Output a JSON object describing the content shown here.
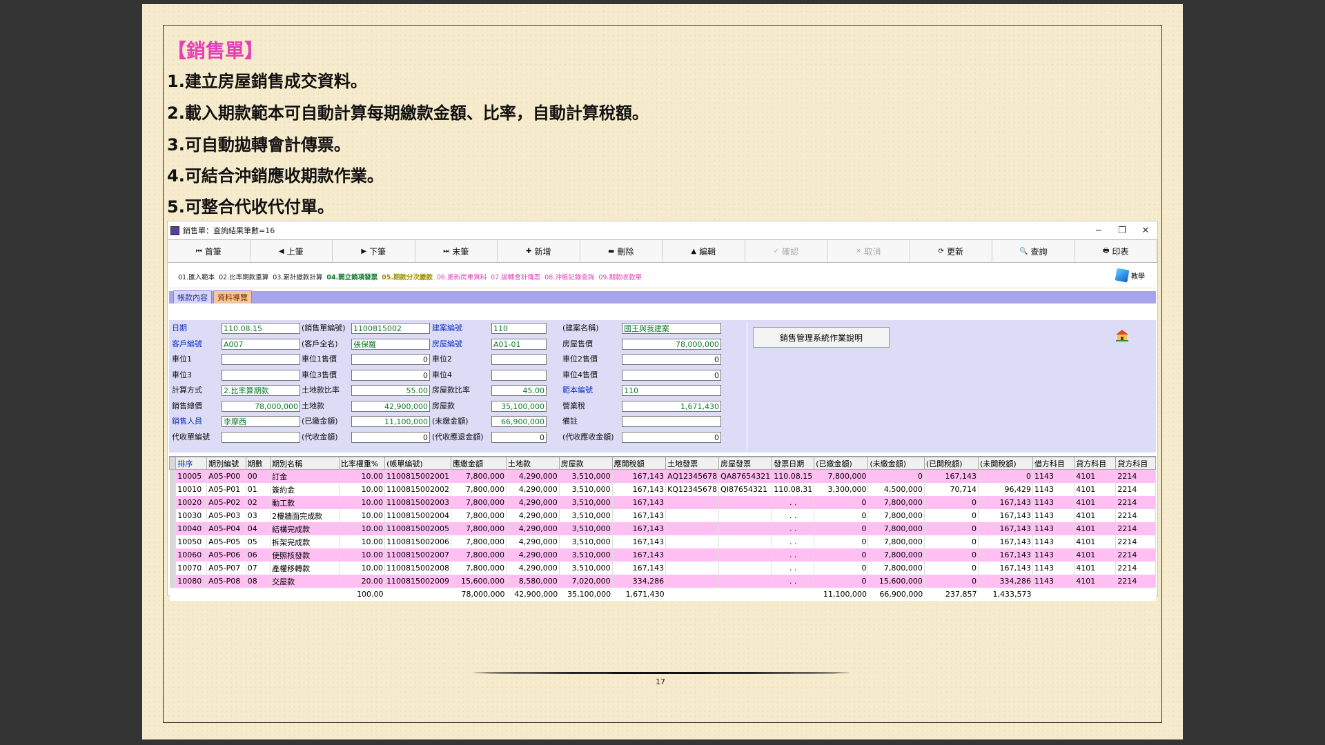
{
  "slide": {
    "title": "【銷售單】",
    "bullets": [
      "1.建立房屋銷售成交資料。",
      "2.載入期款範本可自動計算每期繳款金額、比率，自動計算稅額。",
      "3.可自動拋轉會計傳票。",
      "4.可結合沖銷應收期款作業。",
      "5.可整合代收代付單。"
    ],
    "page_number": "17"
  },
  "window": {
    "title": "銷售單：查詢結果筆數=16",
    "controls": [
      "−",
      "❐",
      "✕"
    ]
  },
  "toolbar": [
    {
      "icon": "⏮",
      "label": "首筆",
      "enabled": true
    },
    {
      "icon": "◀",
      "label": "上筆",
      "enabled": true
    },
    {
      "icon": "▶",
      "label": "下筆",
      "enabled": true
    },
    {
      "icon": "⏭",
      "label": "末筆",
      "enabled": true
    },
    {
      "icon": "✚",
      "label": "新增",
      "enabled": true
    },
    {
      "icon": "▬",
      "label": "刪除",
      "enabled": true
    },
    {
      "icon": "▲",
      "label": "編輯",
      "enabled": true
    },
    {
      "icon": "✓",
      "label": "確認",
      "enabled": false
    },
    {
      "icon": "✕",
      "label": "取消",
      "enabled": false
    },
    {
      "icon": "⟳",
      "label": "更新",
      "enabled": true
    },
    {
      "icon": "🔍",
      "label": "查詢",
      "enabled": true
    },
    {
      "icon": "🖶",
      "label": "印表",
      "enabled": true
    }
  ],
  "function_tabs": [
    {
      "label": "01.匯入範本",
      "style": "gray"
    },
    {
      "label": "02.比率期款重算",
      "style": "gray"
    },
    {
      "label": "03.累計繳款計算",
      "style": "gray"
    },
    {
      "label": "04.開立銷項發票",
      "style": "green"
    },
    {
      "label": "05.期款分次繳款",
      "style": "olive"
    },
    {
      "label": "06.更新房車資料",
      "style": "pink"
    },
    {
      "label": "07.拋轉會計傳票",
      "style": "pink"
    },
    {
      "label": "08.沖帳記錄查詢",
      "style": "pink"
    },
    {
      "label": "09.期款收款單",
      "style": "pink"
    }
  ],
  "math_button": "教學",
  "sub_tabs": [
    "帳款內容",
    "資料導覽"
  ],
  "form": {
    "rows": [
      [
        {
          "label": "日期",
          "blue": true,
          "value": "110.08.15",
          "align": "l",
          "green": true
        },
        {
          "label": "(銷售單編號)",
          "value": "1100815002",
          "align": "l",
          "green": true
        },
        {
          "label": "建案編號",
          "blue": true,
          "value": "110",
          "align": "l",
          "green": true
        },
        {
          "label": "(建案名稱)",
          "value": "國王與我建案",
          "align": "l",
          "green": true
        }
      ],
      [
        {
          "label": "客戶編號",
          "blue": true,
          "value": "A007",
          "align": "l",
          "green": true
        },
        {
          "label": "(客戶全名)",
          "value": "張保羅",
          "align": "l",
          "green": true
        },
        {
          "label": "房屋編號",
          "blue": true,
          "value": "A01-01",
          "align": "l",
          "green": true
        },
        {
          "label": "房屋售價",
          "value": "78,000,000",
          "align": "r",
          "green": true
        }
      ],
      [
        {
          "label": "車位1",
          "value": "",
          "align": "l"
        },
        {
          "label": "車位1售價",
          "value": "0",
          "align": "r"
        },
        {
          "label": "車位2",
          "value": "",
          "align": "l"
        },
        {
          "label": "車位2售價",
          "value": "0",
          "align": "r"
        }
      ],
      [
        {
          "label": "車位3",
          "value": "",
          "align": "l"
        },
        {
          "label": "車位3售價",
          "value": "0",
          "align": "r"
        },
        {
          "label": "車位4",
          "value": "",
          "align": "l"
        },
        {
          "label": "車位4售價",
          "value": "0",
          "align": "r"
        }
      ],
      [
        {
          "label": "計算方式",
          "value": "2.比率算期款",
          "align": "l",
          "green": true
        },
        {
          "label": "土地款比率",
          "value": "55.00",
          "align": "r",
          "green": true
        },
        {
          "label": "房屋款比率",
          "value": "45.00",
          "align": "r",
          "green": true
        },
        {
          "label": "範本編號",
          "blue": true,
          "value": "110",
          "align": "l",
          "green": true
        }
      ],
      [
        {
          "label": "銷售總價",
          "value": "78,000,000",
          "align": "r",
          "green": true
        },
        {
          "label": "土地款",
          "value": "42,900,000",
          "align": "r",
          "green": true
        },
        {
          "label": "房屋款",
          "value": "35,100,000",
          "align": "r",
          "green": true
        },
        {
          "label": "營業稅",
          "value": "1,671,430",
          "align": "r",
          "green": true
        }
      ],
      [
        {
          "label": "銷售人員",
          "blue": true,
          "value": "李摩西",
          "align": "l",
          "green": true
        },
        {
          "label": "(已繳金額)",
          "value": "11,100,000",
          "align": "r",
          "green": true
        },
        {
          "label": "(未繳金額)",
          "value": "66,900,000",
          "align": "r",
          "green": true
        },
        {
          "label": "備註",
          "value": "",
          "align": "l"
        }
      ],
      [
        {
          "label": "代收單編號",
          "value": "",
          "align": "l"
        },
        {
          "label": "(代收金額)",
          "value": "0",
          "align": "r"
        },
        {
          "label": "(代收應退金額)",
          "value": "0",
          "align": "r"
        },
        {
          "label": "(代收應收金額)",
          "value": "0",
          "align": "r"
        }
      ]
    ]
  },
  "help_button": "銷售管理系統作業說明",
  "grid": {
    "headers": [
      "排序",
      "期別編號",
      "期數",
      "期別名稱",
      "比率權重%",
      "(帳單編號)",
      "應繳金額",
      "土地款",
      "房屋款",
      "應開稅額",
      "土地發票",
      "房屋發票",
      "發票日期",
      "(已繳金額)",
      "(未繳金額)",
      "(已開稅額)",
      "(未開稅額)",
      "借方科目",
      "貸方科目",
      "貸方科目"
    ],
    "rows": [
      [
        "10005",
        "A05-P00",
        "00",
        "訂金",
        "10.00",
        "1100815002001",
        "7,800,000",
        "4,290,000",
        "3,510,000",
        "167,143",
        "AQ12345678",
        "QA87654321",
        "110.08.15",
        "7,800,000",
        "0",
        "167,143",
        "0",
        "1143",
        "4101",
        "2214"
      ],
      [
        "10010",
        "A05-P01",
        "01",
        "簽約金",
        "10.00",
        "1100815002002",
        "7,800,000",
        "4,290,000",
        "3,510,000",
        "167,143",
        "KQ12345678",
        "QI87654321",
        "110.08.31",
        "3,300,000",
        "4,500,000",
        "70,714",
        "96,429",
        "1143",
        "4101",
        "2214"
      ],
      [
        "10020",
        "A05-P02",
        "02",
        "動工款",
        "10.00",
        "1100815002003",
        "7,800,000",
        "4,290,000",
        "3,510,000",
        "167,143",
        "",
        "",
        ". .",
        "0",
        "7,800,000",
        "0",
        "167,143",
        "1143",
        "4101",
        "2214"
      ],
      [
        "10030",
        "A05-P03",
        "03",
        "2樓牆面完成款",
        "10.00",
        "1100815002004",
        "7,800,000",
        "4,290,000",
        "3,510,000",
        "167,143",
        "",
        "",
        ". .",
        "0",
        "7,800,000",
        "0",
        "167,143",
        "1143",
        "4101",
        "2214"
      ],
      [
        "10040",
        "A05-P04",
        "04",
        "結構完成款",
        "10.00",
        "1100815002005",
        "7,800,000",
        "4,290,000",
        "3,510,000",
        "167,143",
        "",
        "",
        ". .",
        "0",
        "7,800,000",
        "0",
        "167,143",
        "1143",
        "4101",
        "2214"
      ],
      [
        "10050",
        "A05-P05",
        "05",
        "拆架完成款",
        "10.00",
        "1100815002006",
        "7,800,000",
        "4,290,000",
        "3,510,000",
        "167,143",
        "",
        "",
        ". .",
        "0",
        "7,800,000",
        "0",
        "167,143",
        "1143",
        "4101",
        "2214"
      ],
      [
        "10060",
        "A05-P06",
        "06",
        "使照核發款",
        "10.00",
        "1100815002007",
        "7,800,000",
        "4,290,000",
        "3,510,000",
        "167,143",
        "",
        "",
        ". .",
        "0",
        "7,800,000",
        "0",
        "167,143",
        "1143",
        "4101",
        "2214"
      ],
      [
        "10070",
        "A05-P07",
        "07",
        "產權移轉款",
        "10.00",
        "1100815002008",
        "7,800,000",
        "4,290,000",
        "3,510,000",
        "167,143",
        "",
        "",
        ". .",
        "0",
        "7,800,000",
        "0",
        "167,143",
        "1143",
        "4101",
        "2214"
      ],
      [
        "10080",
        "A05-P08",
        "08",
        "交屋款",
        "20.00",
        "1100815002009",
        "15,600,000",
        "8,580,000",
        "7,020,000",
        "334,286",
        "",
        "",
        ". .",
        "0",
        "15,600,000",
        "0",
        "334,286",
        "1143",
        "4101",
        "2214"
      ]
    ],
    "totals": [
      "",
      "",
      "",
      "",
      "100.00",
      "",
      "78,000,000",
      "42,900,000",
      "35,100,000",
      "1,671,430",
      "",
      "",
      "",
      "11,100,000",
      "66,900,000",
      "237,857",
      "1,433,573",
      "",
      "",
      ""
    ]
  }
}
